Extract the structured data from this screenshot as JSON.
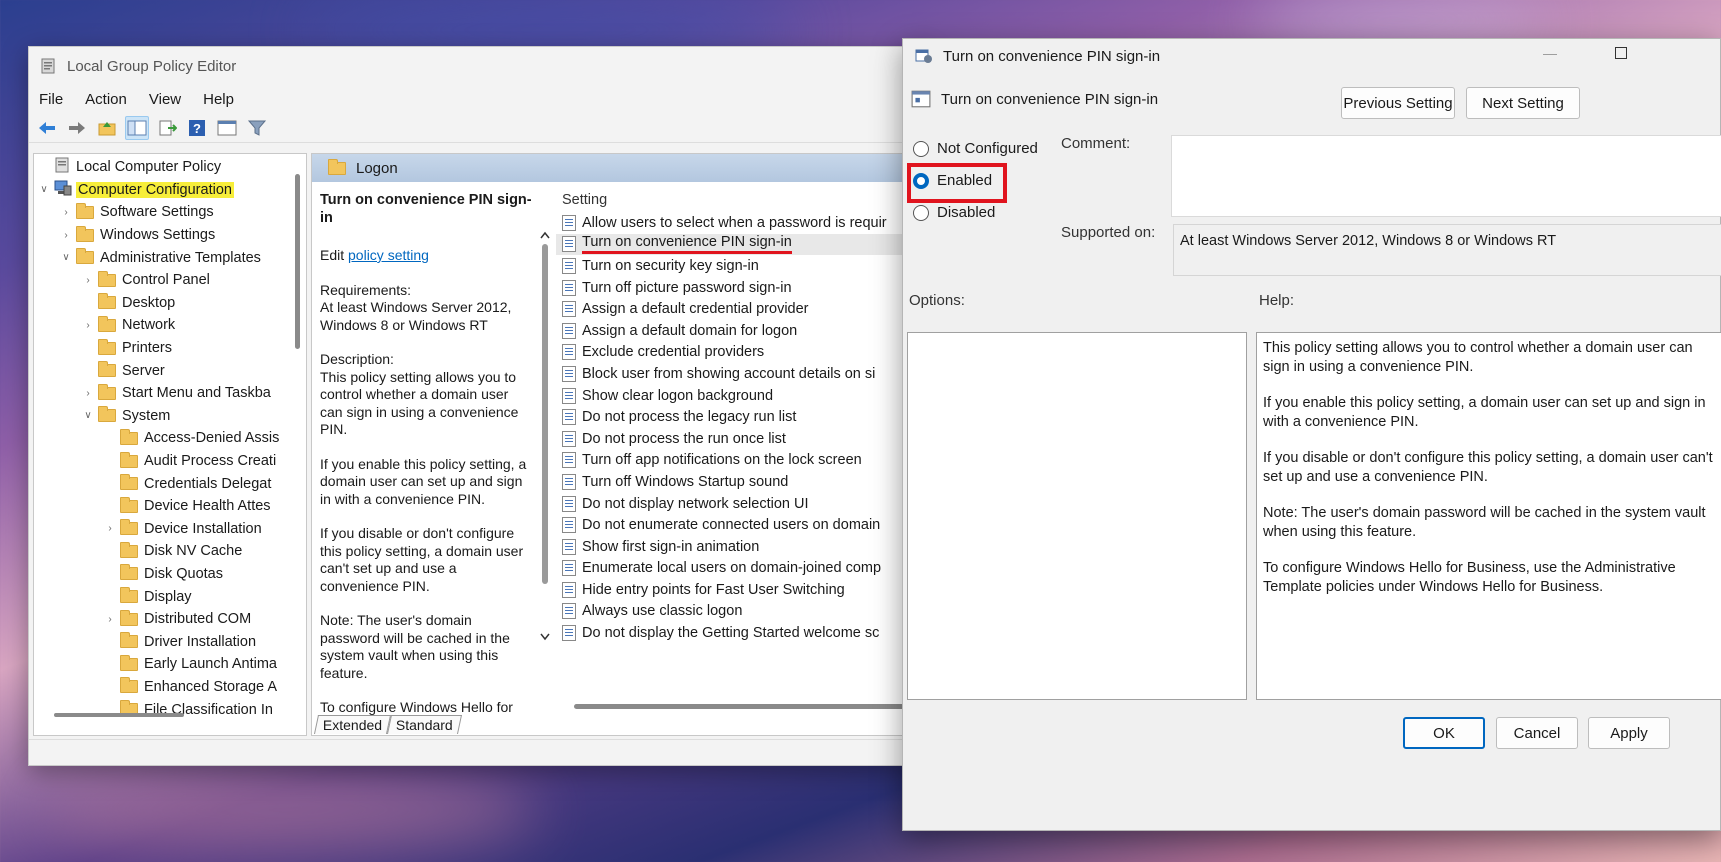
{
  "editor": {
    "title": "Local Group Policy Editor",
    "menu": [
      "File",
      "Action",
      "View",
      "Help"
    ],
    "tree": [
      {
        "label": "Local Computer Policy",
        "indent": 0,
        "arrow": ""
      },
      {
        "label": "Computer Configuration",
        "indent": 0,
        "arrow": "v",
        "highlight": true
      },
      {
        "label": "Software Settings",
        "indent": 1,
        "arrow": ">"
      },
      {
        "label": "Windows Settings",
        "indent": 1,
        "arrow": ">"
      },
      {
        "label": "Administrative Templates",
        "indent": 1,
        "arrow": "v"
      },
      {
        "label": "Control Panel",
        "indent": 2,
        "arrow": ">"
      },
      {
        "label": "Desktop",
        "indent": 2,
        "arrow": ""
      },
      {
        "label": "Network",
        "indent": 2,
        "arrow": ">"
      },
      {
        "label": "Printers",
        "indent": 2,
        "arrow": ""
      },
      {
        "label": "Server",
        "indent": 2,
        "arrow": ""
      },
      {
        "label": "Start Menu and Taskba",
        "indent": 2,
        "arrow": ">"
      },
      {
        "label": "System",
        "indent": 2,
        "arrow": "v"
      },
      {
        "label": "Access-Denied Assis",
        "indent": 3,
        "arrow": ""
      },
      {
        "label": "Audit Process Creati",
        "indent": 3,
        "arrow": ""
      },
      {
        "label": "Credentials Delegat",
        "indent": 3,
        "arrow": ""
      },
      {
        "label": "Device Health Attes",
        "indent": 3,
        "arrow": ""
      },
      {
        "label": "Device Installation",
        "indent": 3,
        "arrow": ">"
      },
      {
        "label": "Disk NV Cache",
        "indent": 3,
        "arrow": ""
      },
      {
        "label": "Disk Quotas",
        "indent": 3,
        "arrow": ""
      },
      {
        "label": "Display",
        "indent": 3,
        "arrow": ""
      },
      {
        "label": "Distributed COM",
        "indent": 3,
        "arrow": ">"
      },
      {
        "label": "Driver Installation",
        "indent": 3,
        "arrow": ""
      },
      {
        "label": "Early Launch Antima",
        "indent": 3,
        "arrow": ""
      },
      {
        "label": "Enhanced Storage A",
        "indent": 3,
        "arrow": ""
      },
      {
        "label": "File Classification In",
        "indent": 3,
        "arrow": ""
      }
    ],
    "folder_header": "Logon",
    "description": {
      "title": "Turn on convenience PIN sign-in",
      "edit_prefix": "Edit ",
      "edit_link": "policy setting ",
      "requirements_label": "Requirements:",
      "requirements": "At least Windows Server 2012, Windows 8 or Windows RT",
      "description_label": "Description:",
      "p1": "This policy setting allows you to control whether a domain user can sign in using a convenience PIN.",
      "p2": "If you enable this policy setting, a domain user can set up and sign in with a convenience PIN.",
      "p3": "If you disable or don't configure this policy setting, a domain user can't set up and use a convenience PIN.",
      "p4": "Note: The user's domain password will be cached in the system vault when using this feature.",
      "p5": "To configure Windows Hello for"
    },
    "settings_header": "Setting",
    "settings": [
      "Allow users to select when a password is requir",
      "Turn on convenience PIN sign-in",
      "Turn on security key sign-in",
      "Turn off picture password sign-in",
      "Assign a default credential provider",
      "Assign a default domain for logon",
      "Exclude credential providers",
      "Block user from showing account details on si",
      "Show clear logon background",
      "Do not process the legacy run list",
      "Do not process the run once list",
      "Turn off app notifications on the lock screen",
      "Turn off Windows Startup sound",
      "Do not display network selection UI",
      "Do not enumerate connected users on domain",
      "Show first sign-in animation",
      "Enumerate local users on domain-joined comp",
      "Hide entry points for Fast User Switching",
      "Always use classic logon",
      "Do not display the Getting Started welcome sc"
    ],
    "selected_index": 1,
    "tabs": [
      "Extended",
      "Standard"
    ]
  },
  "dialog": {
    "title": "Turn on convenience PIN sign-in",
    "subtitle": "Turn on convenience PIN sign-in",
    "prev": "Previous Setting",
    "next": "Next Setting",
    "radio_not_configured": "Not Configured",
    "radio_enabled": "Enabled",
    "radio_disabled": "Disabled",
    "comment_label": "Comment:",
    "supported_label": "Supported on:",
    "supported_value": "At least Windows Server 2012, Windows 8 or Windows RT",
    "options_label": "Options:",
    "help_label": "Help:",
    "help": [
      "This policy setting allows you to control whether a domain user can sign in using a convenience PIN.",
      "If you enable this policy setting, a domain user can set up and sign in with a convenience PIN.",
      "If you disable or don't configure this policy setting, a domain user can't set up and use a convenience PIN.",
      "Note: The user's domain password will be cached in the system vault when using this feature.",
      "To configure Windows Hello for Business, use the Administrative Template policies under Windows Hello for Business."
    ],
    "ok": "OK",
    "cancel": "Cancel",
    "apply": "Apply"
  }
}
